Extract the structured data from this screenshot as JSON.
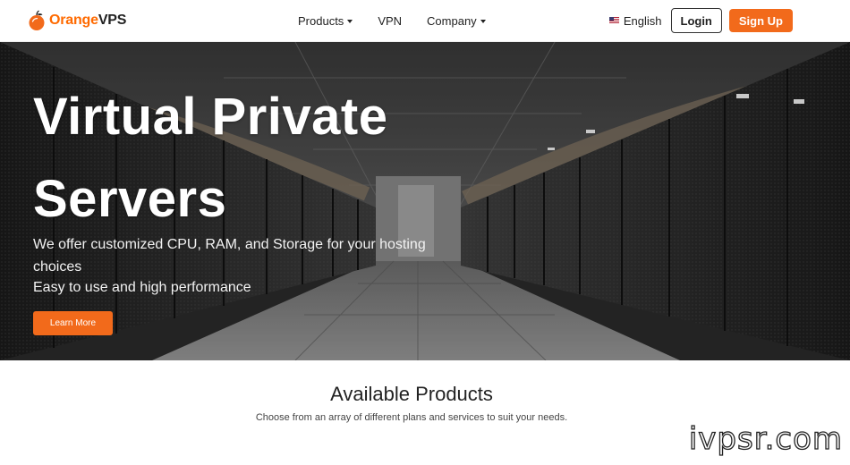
{
  "brand": {
    "name_part1": "Orange",
    "name_part2": "VPS",
    "logo_icon": "orange-fruit-icon",
    "color": "#ff6a00"
  },
  "nav": {
    "items": [
      {
        "label": "Products",
        "has_dropdown": true
      },
      {
        "label": "VPN",
        "has_dropdown": false
      },
      {
        "label": "Company",
        "has_dropdown": true
      }
    ],
    "language": {
      "label": "English",
      "flag_icon": "us-flag-icon"
    },
    "login_label": "Login",
    "signup_label": "Sign Up"
  },
  "hero": {
    "title": "Virtual Private Servers",
    "subtitle": "We offer customized CPU, RAM, and Storage for your hosting choices",
    "subtitle2": "Easy to use and high performance",
    "cta_label": "Learn More",
    "background": "data-center-server-aisle-photo"
  },
  "products": {
    "title": "Available Products",
    "subtitle": "Choose from an array of different plans and services to suit your needs."
  },
  "watermark": "ivpsr.com",
  "colors": {
    "accent": "#f26a1b",
    "text": "#222222"
  }
}
